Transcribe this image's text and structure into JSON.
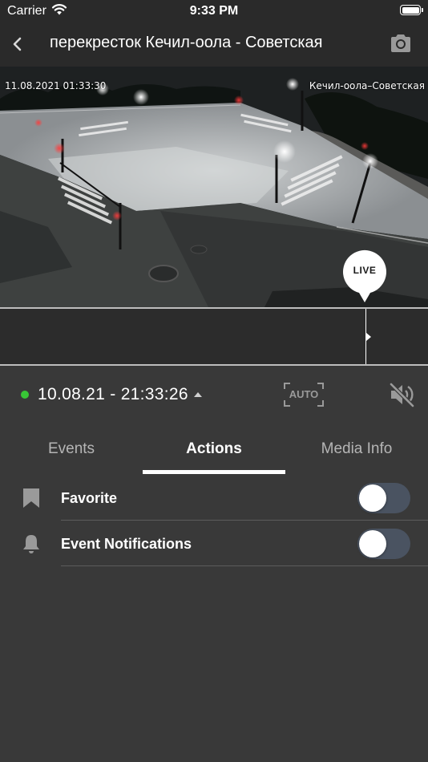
{
  "status_bar": {
    "carrier": "Carrier",
    "time": "9:33 PM"
  },
  "nav": {
    "title": "перекресток Кечил-оола - Советская"
  },
  "video": {
    "osd_timestamp": "11.08.2021 01:33:30",
    "osd_location": "Кечил-оола–Советская",
    "live_label": "LIVE"
  },
  "controls": {
    "datetime": "10.08.21 - 21:33:26",
    "auto_label": "AUTO",
    "status_color": "#38c536"
  },
  "tabs": [
    {
      "label": "Events",
      "active": false
    },
    {
      "label": "Actions",
      "active": true
    },
    {
      "label": "Media Info",
      "active": false
    }
  ],
  "actions": [
    {
      "label": "Favorite",
      "icon": "bookmark-icon",
      "enabled": false
    },
    {
      "label": "Event Notifications",
      "icon": "bell-icon",
      "enabled": false
    }
  ],
  "colors": {
    "background": "#393939",
    "bar": "#2a2a2a",
    "toggle_off": "#4a5361"
  }
}
